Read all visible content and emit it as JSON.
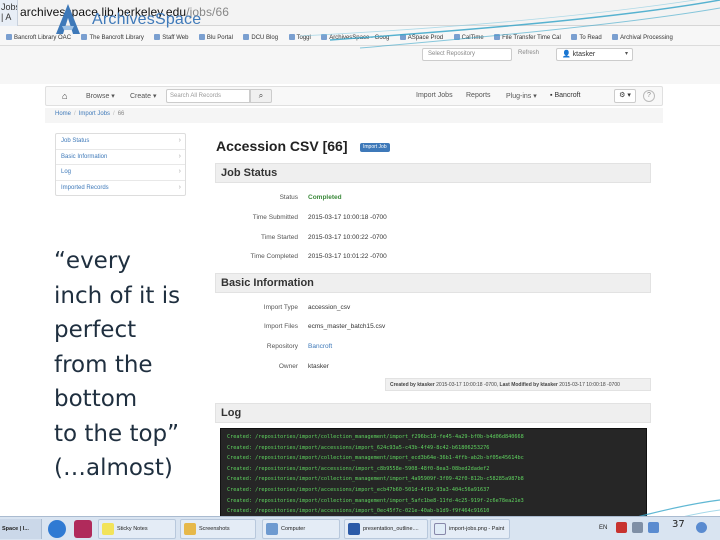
{
  "browser": {
    "tab_label": "Jobs | A",
    "url_host": "archivesspace.lib.berkeley.edu",
    "url_path": "/jobs/66",
    "bookmarks": [
      "Bancroft Library OAC",
      "The Bancroft Library",
      "Staff Web",
      "Blu Portal",
      "DCU Blog",
      "Toggl",
      "ArchivesSpace - Goog",
      "ASpace Prod",
      "CalTime",
      "File Transfer Time Cal",
      "To Read",
      "Archival Processing"
    ]
  },
  "app": {
    "logo_text": "ArchivesSpace",
    "repo_select_placeholder": "Select Repository",
    "refresh_label": "Refresh",
    "user_label": "ktasker",
    "user_caret": "▾"
  },
  "navbar": {
    "home_icon": "home-icon",
    "browse_label": "Browse ▾",
    "create_label": "Create ▾",
    "search_placeholder": "Search All Records",
    "search_icon": "search-icon",
    "import_jobs_label": "Import Jobs",
    "reports_label": "Reports",
    "plugins_label": "Plug-ins ▾",
    "repo_label": "Bancroft",
    "gear_label": "⚙ ▾",
    "help_label": "?"
  },
  "breadcrumb": {
    "home": "Home",
    "import_jobs": "Import Jobs",
    "current": "66"
  },
  "sidebar": {
    "items": [
      {
        "label": "Job Status"
      },
      {
        "label": "Basic Information"
      },
      {
        "label": "Log"
      },
      {
        "label": "Imported Records"
      }
    ]
  },
  "quote": {
    "lines": [
      "“every",
      "inch of it is",
      "perfect",
      "from the",
      "bottom",
      "to the top”",
      "(…almost)"
    ]
  },
  "main": {
    "title": "Accession CSV [66]",
    "badge": "Import Job"
  },
  "job_status": {
    "heading": "Job Status",
    "rows": [
      {
        "label": "Status",
        "value": "Completed"
      },
      {
        "label": "Time Submitted",
        "value": "2015-03-17 10:00:18 -0700"
      },
      {
        "label": "Time Started",
        "value": "2015-03-17 10:00:22 -0700"
      },
      {
        "label": "Time Completed",
        "value": "2015-03-17 10:01:22 -0700"
      }
    ]
  },
  "basic_info": {
    "heading": "Basic Information",
    "rows": [
      {
        "label": "Import Type",
        "value": "accession_csv"
      },
      {
        "label": "Import Files",
        "value": "ecms_master_batch15.csv"
      },
      {
        "label": "Repository",
        "value": "Bancroft"
      },
      {
        "label": "Owner",
        "value": "ktasker"
      }
    ],
    "created_by_prefix": "Created by ktasker",
    "created_by_date": "2015-03-17 10:00:18 -0700",
    "modified_prefix": "Last Modified by ktasker",
    "modified_date": "2015-03-17 10:00:18 -0700"
  },
  "log": {
    "heading": "Log",
    "lines": [
      "Created: /repositories/import/collection_management/import_f296bc18-fe45-4a29-bf0b-b4d06d840668",
      "Created: /repositories/import/accessions/import_624c93a5-c43b-4f49-8c42-b61806253276",
      "Created: /repositories/import/collection_management/import_ecd3b64e-36b1-4ffb-ab2b-bf05e45614bc",
      "Created: /repositories/import/accessions/import_c8b9558e-5908-48f0-8ea3-08bed2dadef2",
      "Created: /repositories/import/collection_management/import_4a95909f-3f09-42f0-812b-c58285a987b8",
      "Created: /repositories/import/accessions/import_ecb47b60-501d-4f19-93a3-404c56a91637",
      "Created: /repositories/import/collection_management/import_5afc1be8-11fd-4c25-919f-2c6e78ea21e3",
      "Created: /repositories/import/accessions/import_0ec45f7c-021e-40ab-b1d9-f9f464c91610"
    ]
  },
  "taskbar": {
    "start_label": "Space | I...",
    "items": [
      "Sticky Notes",
      "Screenshots",
      "Computer",
      "presentation_outline....",
      "import-jobs.png - Paint"
    ],
    "lang": "EN",
    "page_number": "37"
  },
  "colors": {
    "accent": "#3e79b9",
    "completed": "#3c8a3c",
    "log_bg": "#262626",
    "log_text": "#5fd35f",
    "slide_teal": "#3aa6c9"
  }
}
